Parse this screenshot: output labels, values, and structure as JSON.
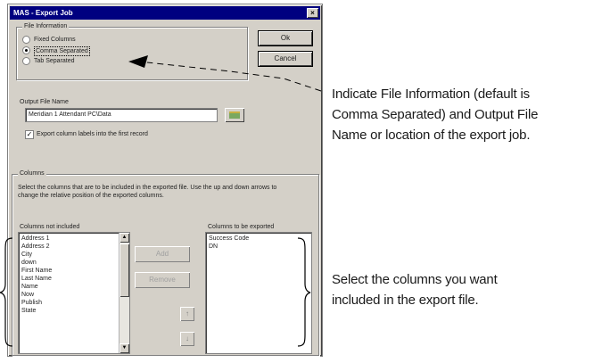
{
  "window": {
    "title": "MAS - Export Job",
    "close_glyph": "×"
  },
  "file_information": {
    "legend": "File Information",
    "options": [
      {
        "label": "Fixed Columns",
        "selected": false
      },
      {
        "label": "Comma Separated",
        "selected": true
      },
      {
        "label": "Tab Separated",
        "selected": false
      }
    ]
  },
  "buttons": {
    "ok": "Ok",
    "cancel": "Cancel",
    "add": "Add",
    "remove": "Remove",
    "up_glyph": "↑",
    "down_glyph": "↓"
  },
  "output": {
    "label": "Output File Name",
    "value": "Meridian 1 Attendant PC\\Data",
    "export_labels_checkbox": "Export column labels into the first record",
    "export_labels_checked": true
  },
  "columns": {
    "legend": "Columns",
    "instructions": "Select the columns that are to be included in the exported file. Use the up and down arrows to change the relative position of the exported columns.",
    "not_included_label": "Columns not included",
    "not_included": [
      "Address 1",
      "Address 2",
      "City",
      "down",
      "First Name",
      "Last Name",
      "Name",
      "Now",
      "Publish",
      "State"
    ],
    "to_export_label": "Columns to be exported",
    "to_export": [
      "Success Code",
      "DN"
    ]
  },
  "annotations": {
    "file_info": [
      "Indicate File Information (default is",
      "Comma Separated) and Output File",
      "Name or location of the export job."
    ],
    "columns": [
      "Select the columns you want",
      "included in the export file."
    ]
  }
}
